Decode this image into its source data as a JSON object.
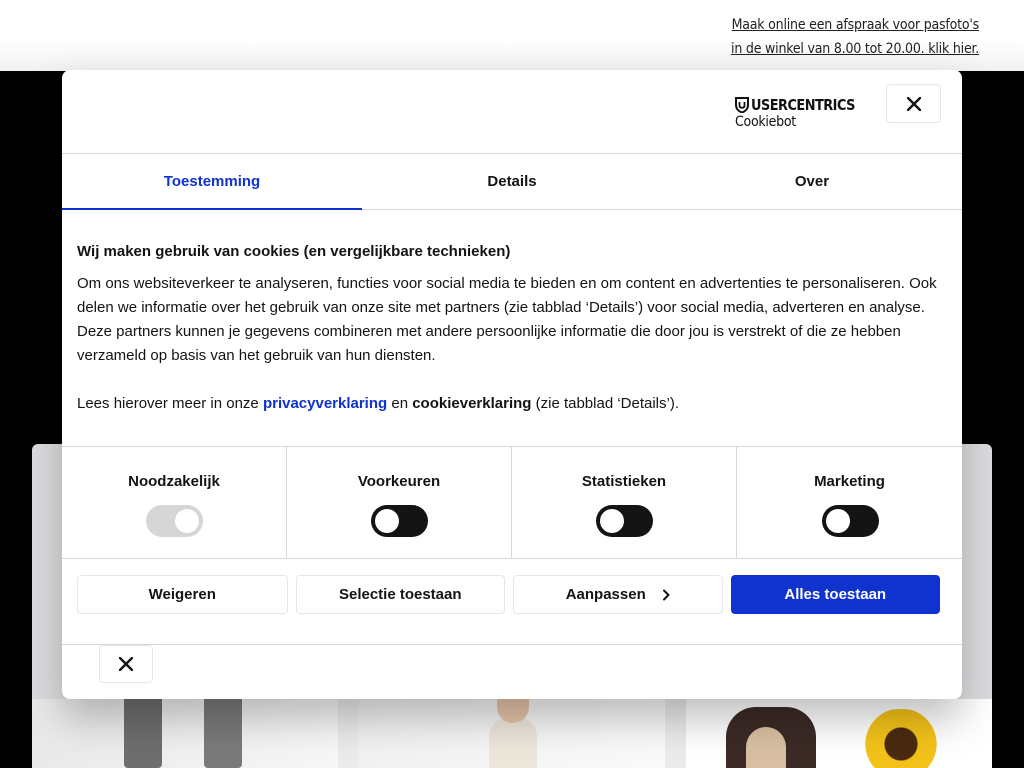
{
  "topbar": {
    "link_line1": "Maak online een afspraak voor pasfoto's",
    "link_line2": "in de winkel van 8.00 tot 20.00. klik hier."
  },
  "dialog": {
    "brand": {
      "name": "USERCENTRICS",
      "sub": "Cookiebot",
      "icon": "shield-icon"
    },
    "close_icon": "close-icon",
    "tabs": [
      {
        "label": "Toestemming",
        "active": true
      },
      {
        "label": "Details",
        "active": false
      },
      {
        "label": "Over",
        "active": false
      }
    ],
    "heading": "Wij maken gebruik van cookies (en vergelijkbare technieken)",
    "paragraph": "Om ons websiteverkeer te analyseren, functies voor social media te bieden en om content en advertenties te personaliseren. Ook delen we informatie over het gebruik van onze site met partners (zie tabblad ‘Details’) voor social media, adverteren en analyse. Deze partners kunnen je gegevens combineren met andere persoonlijke informatie die door jou is verstrekt of die ze hebben verzameld op basis van het gebruik van hun diensten.",
    "more": {
      "prefix": "Lees hierover meer in onze ",
      "privacy_link": "privacyverklaring",
      "middle": " en ",
      "cookie_label": "cookieverklaring",
      "suffix": " (zie tabblad ‘Details’)."
    },
    "toggles": [
      {
        "label": "Noodzakelijk",
        "on": true,
        "disabled": true
      },
      {
        "label": "Voorkeuren",
        "on": false,
        "disabled": false
      },
      {
        "label": "Statistieken",
        "on": false,
        "disabled": false
      },
      {
        "label": "Marketing",
        "on": false,
        "disabled": false
      }
    ],
    "buttons": {
      "reject": "Weigeren",
      "select": "Selectie toestaan",
      "customize": "Aanpassen",
      "allow_all": "Alles toestaan"
    },
    "colors": {
      "accent": "#1032cf",
      "border": "#d6d6d6",
      "text": "#141414"
    }
  }
}
